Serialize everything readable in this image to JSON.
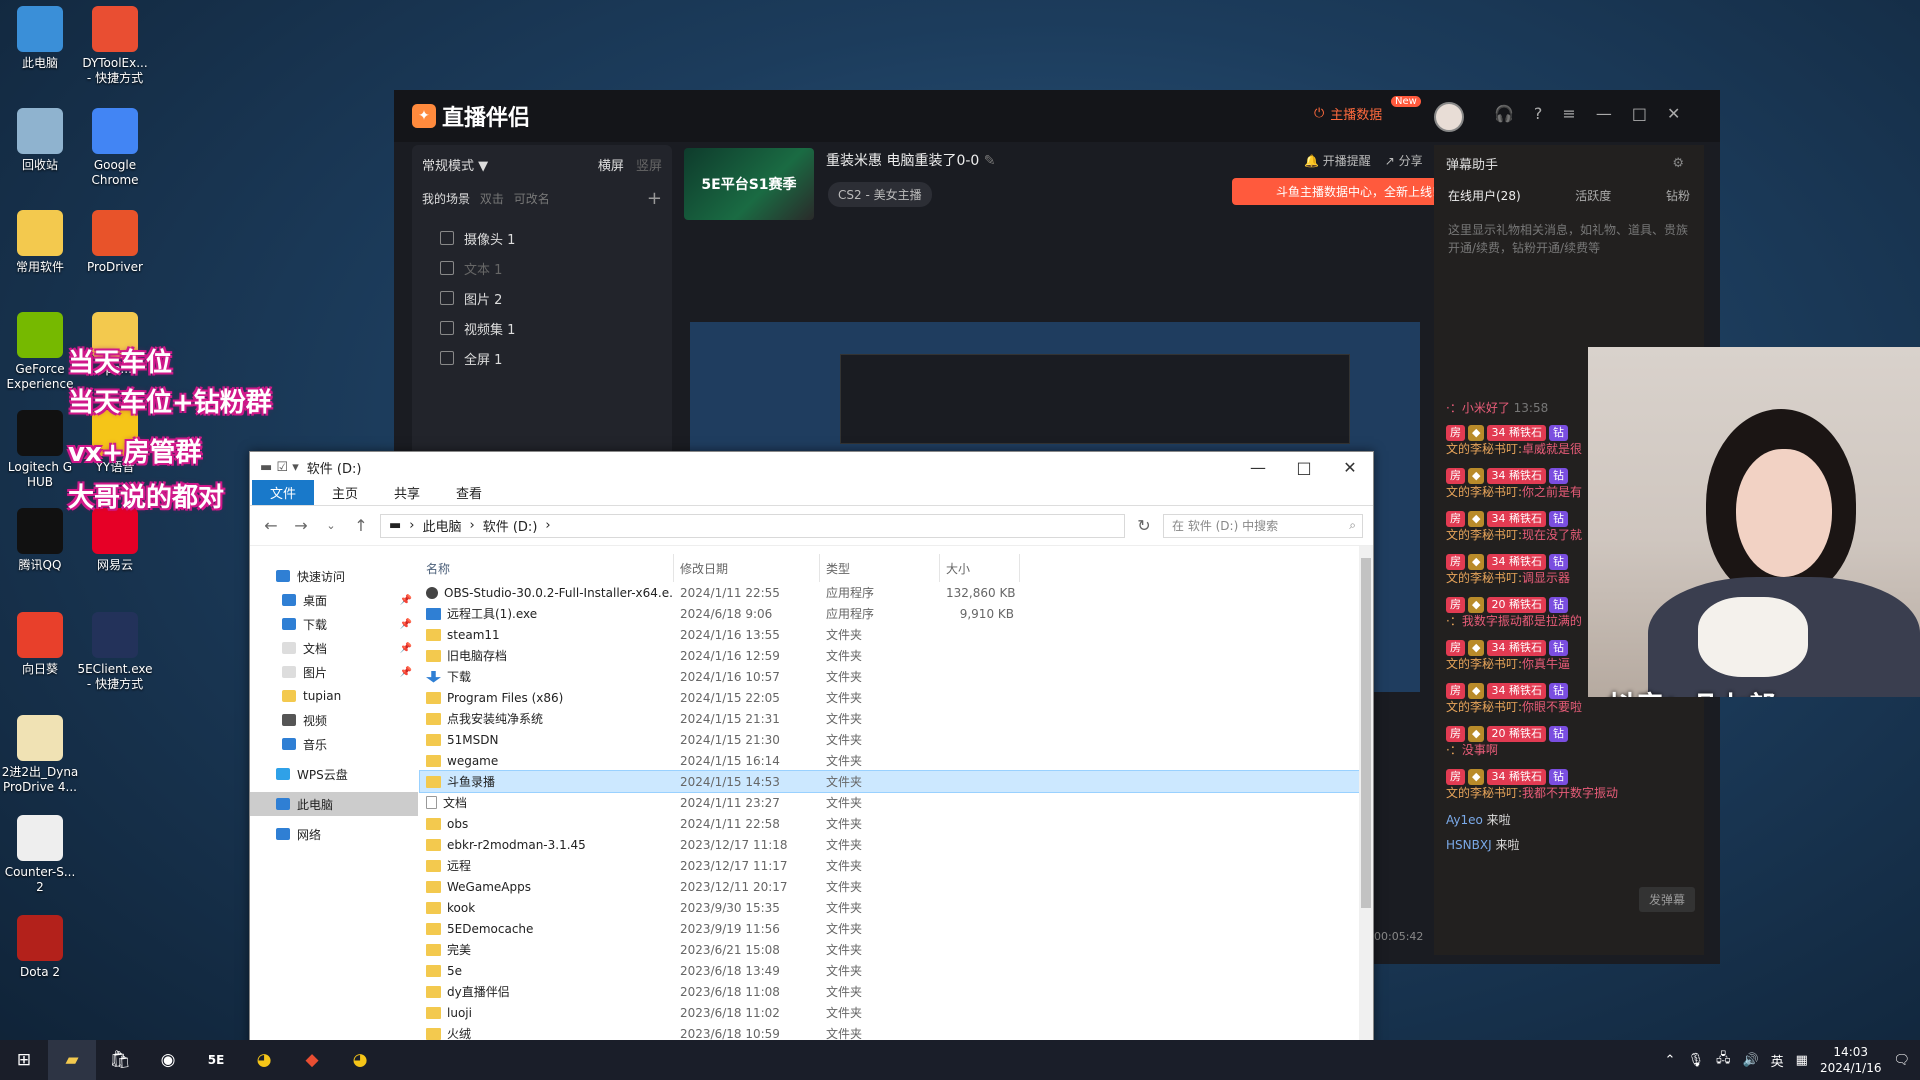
{
  "desktop": {
    "icons": [
      {
        "label": "此电脑",
        "icon": "computer-icon",
        "color": "#3a8fd8"
      },
      {
        "label": "DYToolEx...\n- 快捷方式",
        "icon": "dytool-icon",
        "color": "#e94e32"
      },
      {
        "label": "回收站",
        "icon": "recycle-bin-icon",
        "color": "#8fb3cf"
      },
      {
        "label": "Google\nChrome",
        "icon": "chrome-icon",
        "color": "#4285f4"
      },
      {
        "label": "常用软件",
        "icon": "folder-icon",
        "color": "#f3c94e"
      },
      {
        "label": "ProDriver",
        "icon": "prodriver-icon",
        "color": "#e8532a"
      },
      {
        "label": "GeForce\nExperience",
        "icon": "geforce-icon",
        "color": "#76b900"
      },
      {
        "label": "ope...",
        "icon": "folder-icon",
        "color": "#f3c94e"
      },
      {
        "label": "Logitech G\nHUB",
        "icon": "logitech-icon",
        "color": "#111"
      },
      {
        "label": "YY语音",
        "icon": "yy-icon",
        "color": "#f5c518"
      },
      {
        "label": "腾讯QQ",
        "icon": "qq-icon",
        "color": "#111"
      },
      {
        "label": "网易云",
        "icon": "netease-music-icon",
        "color": "#e60026"
      },
      {
        "label": "向日葵",
        "icon": "sunflower-icon",
        "color": "#e8402b"
      },
      {
        "label": "5EClient.exe\n- 快捷方式",
        "icon": "5e-icon",
        "color": "#23325a"
      },
      {
        "label": "2进2出_Dyna\nProDrive 4...",
        "icon": "document-icon",
        "color": "#f0e2b4"
      },
      {
        "label": "Counter-S...\n2",
        "icon": "document-icon",
        "color": "#eeeeee"
      },
      {
        "label": "Dota 2",
        "icon": "dota-icon",
        "color": "#b3211b"
      }
    ],
    "promo_lines": [
      "当天车位",
      "当天车位+钻粉群",
      "vx+房管群",
      "大哥说的都对"
    ]
  },
  "streamer": {
    "app_name": "直播伴侣",
    "host_data_label": "主播数据",
    "new_badge": "New",
    "mode_label": "常规模式",
    "orientation": [
      "横屏",
      "竖屏"
    ],
    "scenes_label": "我的场景",
    "scenes_hint": "双击",
    "scenes_hint2": "可改名",
    "scenes": [
      {
        "name": "摄像头 1",
        "dim": false
      },
      {
        "name": "文本 1",
        "dim": true
      },
      {
        "name": "图片 2",
        "dim": false
      },
      {
        "name": "视频集 1",
        "dim": false
      },
      {
        "name": "全屏 1",
        "dim": false
      }
    ],
    "stream_title": "重装米惠 电脑重装了0-0",
    "category": "CS2 - 美女主播",
    "thumb_text": "5E平台S1赛季",
    "start_reminder": "开播提醒",
    "share_label": "分享",
    "notice": "斗鱼主播数据中心，全新上线!",
    "timer": "00:05:42",
    "danmu": {
      "title": "弹幕助手",
      "tabs": [
        "在线用户(28)",
        "活跃度",
        "钻粉"
      ],
      "hint": "这里显示礼物相关消息，如礼物、道具、贵族开通/续费，钻粉开通/续费等",
      "first_msg": "·：小米好了",
      "first_time": "13:58",
      "messages": [
        {
          "level": "34",
          "name": "文的李秘书叮:",
          "text": "卓威就是很"
        },
        {
          "level": "34",
          "name": "文的李秘书叮:",
          "text": "你之前是有"
        },
        {
          "level": "34",
          "name": "文的李秘书叮:",
          "text": "现在没了就"
        },
        {
          "level": "34",
          "name": "文的李秘书叮:",
          "text": "调显示器"
        },
        {
          "level": "20",
          "name": "·：",
          "text": "我数字振动都是拉满的"
        },
        {
          "level": "34",
          "name": "文的李秘书叮:",
          "text": "你真牛逼"
        },
        {
          "level": "34",
          "name": "文的李秘书叮:",
          "text": "你眼不要啦"
        },
        {
          "level": "20",
          "name": "·：",
          "text": "没事啊"
        },
        {
          "level": "34",
          "name": "文的李秘书叮:",
          "text": "我都不开数字振动"
        }
      ],
      "enter": [
        {
          "user": "Ay1eo",
          "text": "来啦"
        },
        {
          "user": "HSNBXJ",
          "text": "来啦"
        }
      ],
      "send_button": "发弹幕"
    },
    "cam_overlay": "抖音：凡七郎"
  },
  "explorer": {
    "title": "软件 (D:)",
    "ribbon_tabs": [
      "文件",
      "主页",
      "共享",
      "查看"
    ],
    "breadcrumb": [
      "此电脑",
      "软件 (D:)"
    ],
    "search_placeholder": "在 软件 (D:) 中搜索",
    "nav": [
      {
        "label": "快速访问",
        "kind": "star",
        "pinned": false,
        "sub": false
      },
      {
        "label": "桌面",
        "kind": "desk",
        "pinned": true,
        "sub": true
      },
      {
        "label": "下载",
        "kind": "dl",
        "pinned": true,
        "sub": true
      },
      {
        "label": "文档",
        "kind": "doc",
        "pinned": true,
        "sub": true
      },
      {
        "label": "图片",
        "kind": "pic",
        "pinned": true,
        "sub": true
      },
      {
        "label": "tupian",
        "kind": "folder",
        "pinned": false,
        "sub": true
      },
      {
        "label": "视频",
        "kind": "video",
        "pinned": false,
        "sub": true
      },
      {
        "label": "音乐",
        "kind": "music",
        "pinned": false,
        "sub": true
      },
      {
        "label": "WPS云盘",
        "kind": "cloud",
        "pinned": false,
        "sub": false
      },
      {
        "label": "此电脑",
        "kind": "pc",
        "pinned": false,
        "sub": false
      },
      {
        "label": "网络",
        "kind": "net",
        "pinned": false,
        "sub": false
      }
    ],
    "columns": [
      "名称",
      "修改日期",
      "类型",
      "大小"
    ],
    "files": [
      {
        "name": "OBS-Studio-30.0.2-Full-Installer-x64.e...",
        "date": "2024/1/11 22:55",
        "type": "应用程序",
        "size": "132,860 KB",
        "icon": "app"
      },
      {
        "name": "远程工具(1).exe",
        "date": "2024/6/18 9:06",
        "type": "应用程序",
        "size": "9,910 KB",
        "icon": "exe"
      },
      {
        "name": "steam11",
        "date": "2024/1/16 13:55",
        "type": "文件夹",
        "size": "",
        "icon": "folder"
      },
      {
        "name": "旧电脑存档",
        "date": "2024/1/16 12:59",
        "type": "文件夹",
        "size": "",
        "icon": "folder"
      },
      {
        "name": "下载",
        "date": "2024/1/16 10:57",
        "type": "文件夹",
        "size": "",
        "icon": "dl"
      },
      {
        "name": "Program Files (x86)",
        "date": "2024/1/15 22:05",
        "type": "文件夹",
        "size": "",
        "icon": "folder"
      },
      {
        "name": "点我安装纯净系统",
        "date": "2024/1/15 21:31",
        "type": "文件夹",
        "size": "",
        "icon": "folder"
      },
      {
        "name": "51MSDN",
        "date": "2024/1/15 21:30",
        "type": "文件夹",
        "size": "",
        "icon": "folder"
      },
      {
        "name": "wegame",
        "date": "2024/1/15 16:14",
        "type": "文件夹",
        "size": "",
        "icon": "folder"
      },
      {
        "name": "斗鱼录播",
        "date": "2024/1/15 14:53",
        "type": "文件夹",
        "size": "",
        "icon": "folder",
        "selected": true
      },
      {
        "name": "文档",
        "date": "2024/1/11 23:27",
        "type": "文件夹",
        "size": "",
        "icon": "doc"
      },
      {
        "name": "obs",
        "date": "2024/1/11 22:58",
        "type": "文件夹",
        "size": "",
        "icon": "folder"
      },
      {
        "name": "ebkr-r2modman-3.1.45",
        "date": "2023/12/17 11:18",
        "type": "文件夹",
        "size": "",
        "icon": "folder"
      },
      {
        "name": "远程",
        "date": "2023/12/17 11:17",
        "type": "文件夹",
        "size": "",
        "icon": "folder"
      },
      {
        "name": "WeGameApps",
        "date": "2023/12/11 20:17",
        "type": "文件夹",
        "size": "",
        "icon": "folder"
      },
      {
        "name": "kook",
        "date": "2023/9/30 15:35",
        "type": "文件夹",
        "size": "",
        "icon": "folder"
      },
      {
        "name": "5EDemocache",
        "date": "2023/9/19 11:56",
        "type": "文件夹",
        "size": "",
        "icon": "folder"
      },
      {
        "name": "完美",
        "date": "2023/6/21 15:08",
        "type": "文件夹",
        "size": "",
        "icon": "folder"
      },
      {
        "name": "5e",
        "date": "2023/6/18 13:49",
        "type": "文件夹",
        "size": "",
        "icon": "folder"
      },
      {
        "name": "dy直播伴侣",
        "date": "2023/6/18 11:08",
        "type": "文件夹",
        "size": "",
        "icon": "folder"
      },
      {
        "name": "luoji",
        "date": "2023/6/18 11:02",
        "type": "文件夹",
        "size": "",
        "icon": "folder"
      },
      {
        "name": "火绒",
        "date": "2023/6/18 10:59",
        "type": "文件夹",
        "size": "",
        "icon": "folder"
      }
    ]
  },
  "taskbar": {
    "ime": "英",
    "time": "14:03",
    "date": "2024/1/16"
  }
}
